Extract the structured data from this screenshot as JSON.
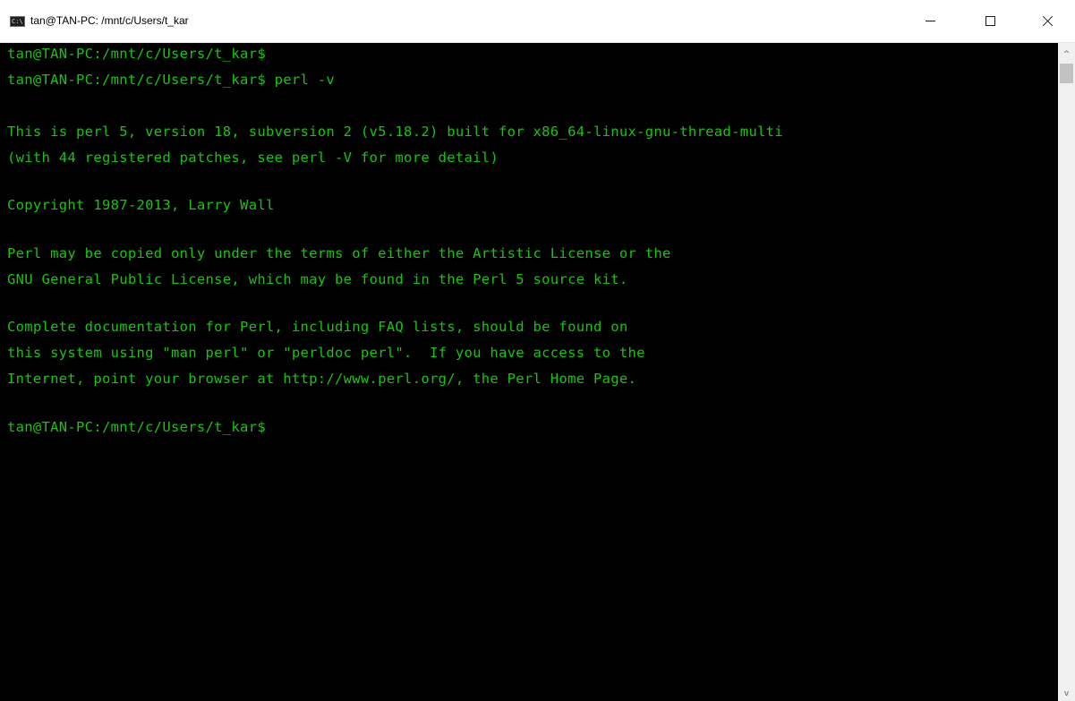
{
  "window": {
    "title": "tan@TAN-PC: /mnt/c/Users/t_kar",
    "icon": "console-app-icon",
    "icon_label": "C:\\"
  },
  "caption_buttons": {
    "minimize": "minimize-icon",
    "maximize": "maximize-icon",
    "close": "close-icon"
  },
  "terminal": {
    "text_color": "#16c60c",
    "background": "#000000",
    "lines": [
      "tan@TAN-PC:/mnt/c/Users/t_kar$",
      "tan@TAN-PC:/mnt/c/Users/t_kar$ perl -v",
      "",
      "This is perl 5, version 18, subversion 2 (v5.18.2) built for x86_64-linux-gnu-thread-multi",
      "(with 44 registered patches, see perl -V for more detail)",
      "",
      "Copyright 1987-2013, Larry Wall",
      "",
      "Perl may be copied only under the terms of either the Artistic License or the",
      "GNU General Public License, which may be found in the Perl 5 source kit.",
      "",
      "Complete documentation for Perl, including FAQ lists, should be found on",
      "this system using \"man perl\" or \"perldoc perl\".  If you have access to the",
      "Internet, point your browser at http://www.perl.org/, the Perl Home Page.",
      "",
      "tan@TAN-PC:/mnt/c/Users/t_kar$"
    ]
  },
  "scrollbar": {
    "up_icon": "scroll-up-arrow-icon",
    "down_icon": "scroll-down-arrow-icon",
    "up_glyph": "^",
    "down_glyph": "v"
  }
}
